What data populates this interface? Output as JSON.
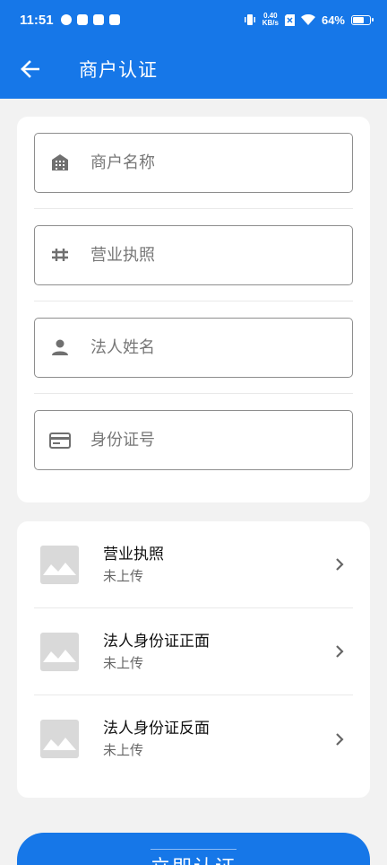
{
  "status_bar": {
    "time": "11:51",
    "net_speed_value": "0.40",
    "net_speed_unit": "KB/s",
    "battery_percent": "64%",
    "battery_level": 0.64
  },
  "header": {
    "title": "商户认证",
    "back_icon": "arrow-left-icon"
  },
  "form": {
    "fields": [
      {
        "placeholder": "商户名称",
        "icon": "building-icon"
      },
      {
        "placeholder": "营业执照",
        "icon": "license-icon"
      },
      {
        "placeholder": "法人姓名",
        "icon": "person-icon"
      },
      {
        "placeholder": "身份证号",
        "icon": "id-card-icon"
      }
    ]
  },
  "uploads": [
    {
      "title": "营业执照",
      "status": "未上传"
    },
    {
      "title": "法人身份证正面",
      "status": "未上传"
    },
    {
      "title": "法人身份证反面",
      "status": "未上传"
    }
  ],
  "submit": {
    "label": "立即认证"
  },
  "colors": {
    "primary": "#1677e8",
    "background": "#f2f2f2",
    "placeholder_icon": "#d9d9d9"
  }
}
